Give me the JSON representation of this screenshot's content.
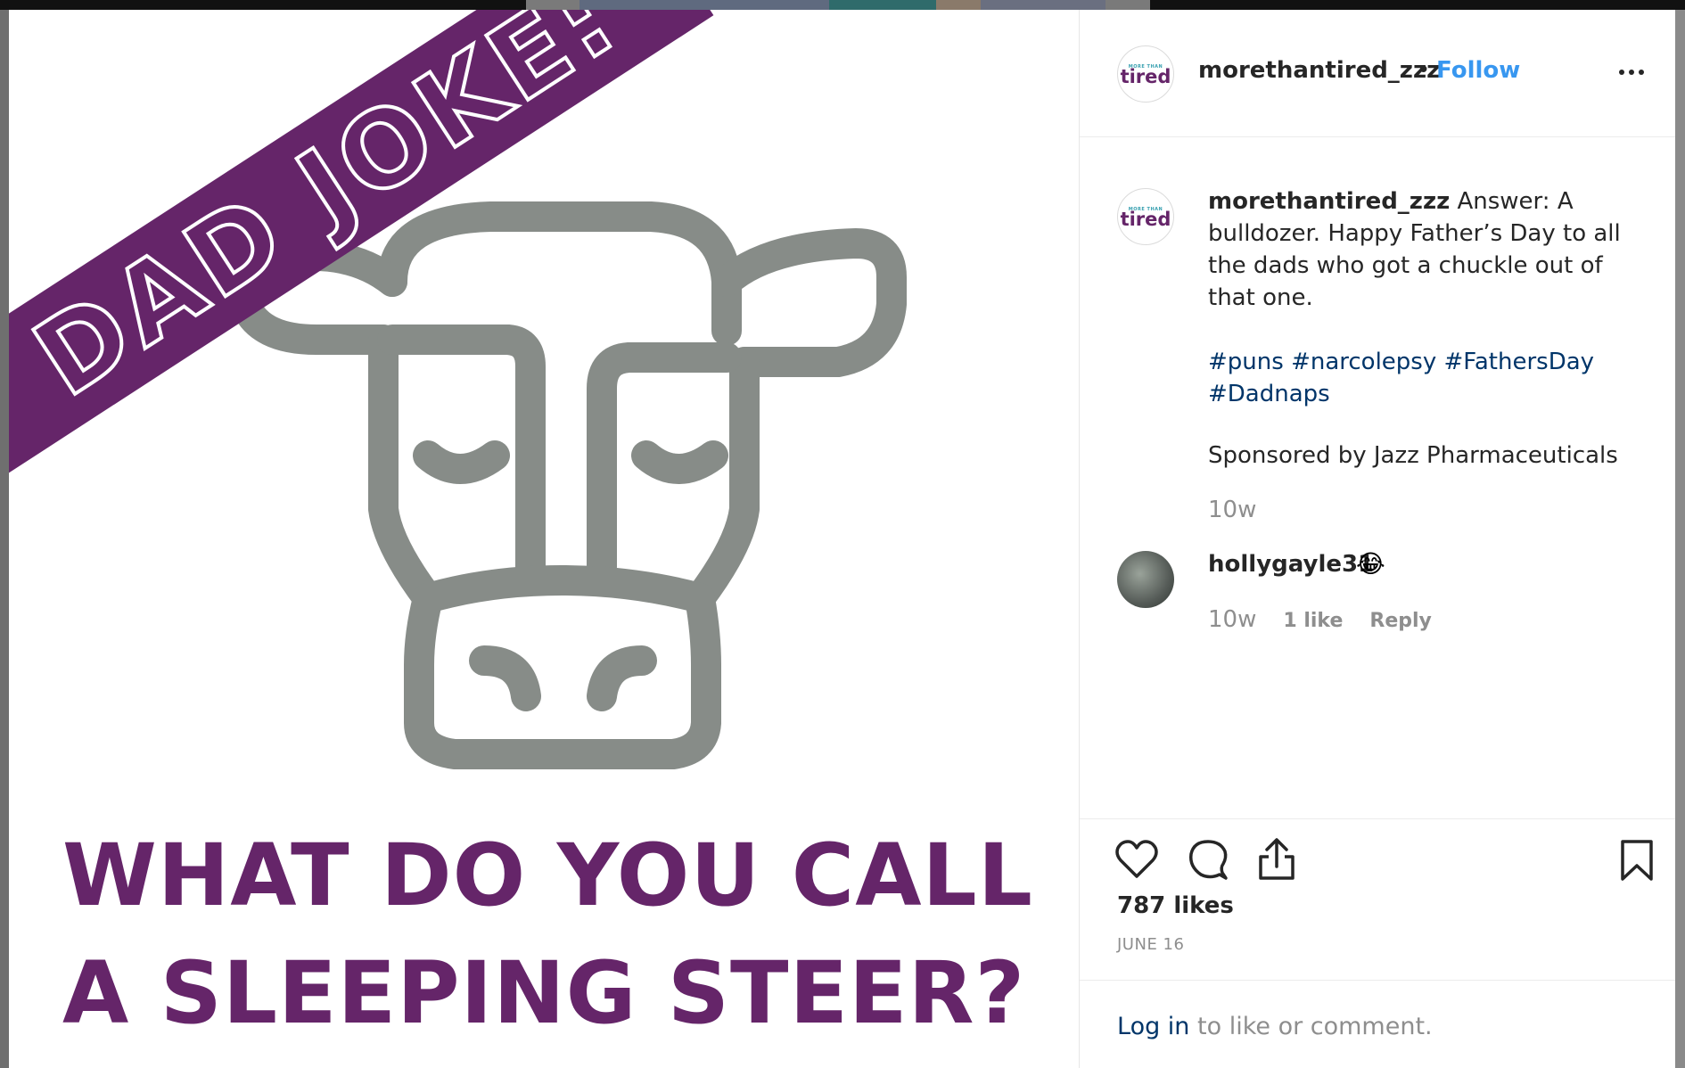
{
  "post_image": {
    "banner": "DAD JOKE:",
    "question_line1": "WHAT DO YOU CALL",
    "question_line2": "A SLEEPING STEER?"
  },
  "header": {
    "avatar_text_small": "MORE THAN",
    "avatar_text": "tired",
    "username": "morethantired_zzz",
    "separator": "•",
    "follow_label": "Follow"
  },
  "caption": {
    "username": "morethantired_zzz",
    "text": "Answer: A bulldozer. Happy Father’s Day to all the dads who got a chuckle out of that one.",
    "hashtags": [
      "#puns",
      "#narcolepsy",
      "#FathersDay",
      "#Dadnaps"
    ],
    "sponsor": "Sponsored by Jazz Pharmaceuticals",
    "time": "10w"
  },
  "comment": {
    "username": "hollygayle31",
    "emoji": "😂",
    "time": "10w",
    "likes": "1 like",
    "reply_label": "Reply"
  },
  "actions": {
    "likes": "787 likes",
    "date": "JUNE 16"
  },
  "login": {
    "link": "Log in",
    "text": " to like or comment."
  },
  "colors": {
    "brand_purple": "#652569",
    "cow_gray": "#878c88",
    "link_blue": "#3897f0",
    "hashtag_blue": "#003569"
  }
}
